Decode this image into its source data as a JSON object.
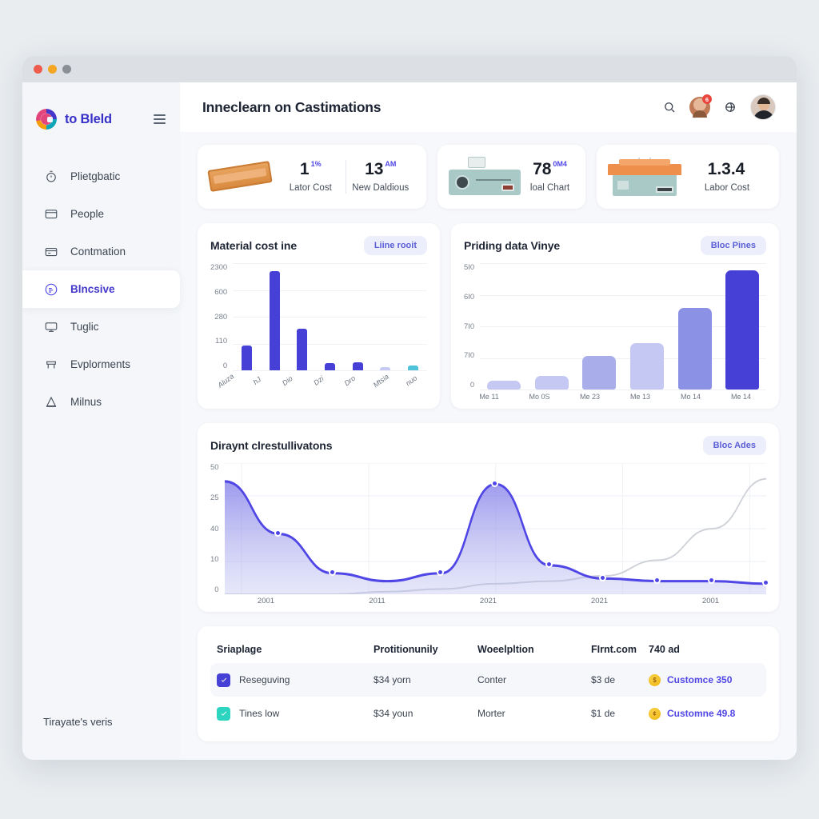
{
  "window": {
    "dots": [
      "close",
      "minimize",
      "maximize"
    ]
  },
  "sidebar": {
    "brand": "to Bleld",
    "menu_icon": "hamburger-icon",
    "items": [
      {
        "label": "Plietgbatic",
        "icon": "stopwatch-icon",
        "active": false
      },
      {
        "label": "People",
        "icon": "monitor-icon",
        "active": false
      },
      {
        "label": "Contmation",
        "icon": "card-icon",
        "active": false
      },
      {
        "label": "Blncsive",
        "icon": "circle-face-icon",
        "active": true
      },
      {
        "label": "Tuglic",
        "icon": "display-icon",
        "active": false
      },
      {
        "label": "Evplorments",
        "icon": "bench-icon",
        "active": false
      },
      {
        "label": "Milnus",
        "icon": "cone-icon",
        "active": false
      }
    ],
    "footer": {
      "label": "Tirayate's veris",
      "icon": "home-shield-icon"
    }
  },
  "header": {
    "title": "Inneclearn on Castimations",
    "search_icon": "search-icon",
    "notification_badge": "6",
    "globe_icon": "globe-icon",
    "avatar": "user-avatar"
  },
  "kpis": [
    {
      "value": "1",
      "sup": "1%",
      "label": "Lator Cost",
      "illustration": "wood-plank"
    },
    {
      "value": "13",
      "sup": "AM",
      "label": "New Daldious",
      "illustration": "none"
    },
    {
      "value": "78",
      "sup": "0M4",
      "label": "loal Chart",
      "illustration": "machine"
    },
    {
      "value": "1.3.4",
      "sup": "",
      "label": "Labor Cost",
      "illustration": "house"
    }
  ],
  "chart_data": [
    {
      "type": "bar",
      "title": "Material cost ine",
      "action_label": "Liine rooit",
      "categories": [
        "Aluza",
        "hJ",
        "Dio",
        "Dzi",
        "Dro",
        "Mtsia",
        "nuo"
      ],
      "values": [
        180,
        720,
        300,
        55,
        58,
        22,
        35
      ],
      "ylim": [
        0,
        780
      ],
      "ytick_labels": [
        "2300",
        "600",
        "280",
        "110",
        "0"
      ],
      "bar_colors": [
        "#4640d6",
        "#4640d6",
        "#4640d6",
        "#4640d6",
        "#4640d6",
        "#c7caf2",
        "#4fc3d9"
      ],
      "grid": true,
      "xlabel": "",
      "ylabel": ""
    },
    {
      "type": "bar",
      "title": "Priding data Vinye",
      "action_label": "Bloc Pines",
      "categories": [
        "Me 11",
        "Mo 0S",
        "Me 23",
        "Me 13",
        "Mo 14",
        "Me 14"
      ],
      "values": [
        12,
        18,
        45,
        62,
        110,
        160
      ],
      "ylim": [
        0,
        170
      ],
      "ytick_labels": [
        "5I0",
        "6I0",
        "7I0",
        "7I0",
        "0"
      ],
      "bar_colors": [
        "#c4c8f2",
        "#c4c8f2",
        "#a9aeeb",
        "#c4c8f2",
        "#8b92e6",
        "#4640d6"
      ],
      "grid": true,
      "xlabel": "",
      "ylabel": ""
    },
    {
      "type": "area",
      "title": "Diraynt clrestullivatons",
      "action_label": "Bloc Ades",
      "ytick_labels": [
        "50",
        "25",
        "40",
        "10",
        "0"
      ],
      "ylim": [
        0,
        50
      ],
      "x_tick_labels": [
        "2001",
        "2011",
        "2021",
        "2021",
        "2001"
      ],
      "series": [
        {
          "name": "primary",
          "color": "#4f46e5",
          "values": [
            43,
            23,
            8,
            5,
            8,
            42,
            11,
            6,
            5,
            5,
            4
          ],
          "marker_indices": [
            1,
            2,
            4,
            5,
            6,
            7,
            8,
            9,
            10
          ]
        },
        {
          "name": "secondary",
          "color": "#cfd2d8",
          "values": [
            0,
            0,
            0,
            1,
            2,
            4,
            5,
            7,
            13,
            25,
            44
          ]
        }
      ],
      "grid": true
    }
  ],
  "table": {
    "columns": [
      "Sriaplage",
      "Protitionunily",
      "Woeelpltion",
      "FIrnt.com",
      "740 ad"
    ],
    "rows": [
      {
        "checkbox_color": "#4640d6",
        "name": "Reseguving",
        "price": "$34 yorn",
        "type": "Conter",
        "cost": "$3 de",
        "customer": "Customce 350",
        "coin_icon": "coin-icon"
      },
      {
        "checkbox_color": "#2dd4bf",
        "name": "Tines low",
        "price": "$34 youn",
        "type": "Morter",
        "cost": "$1 de",
        "customer": "Customne 49.8",
        "coin_icon": "coin-icon"
      }
    ]
  },
  "colors": {
    "accent": "#4f46e5",
    "accent_dark": "#4640d6",
    "page_bg": "#f7f8fb",
    "sidebar_bg": "#f4f6f9",
    "teal": "#4fc3d9"
  }
}
